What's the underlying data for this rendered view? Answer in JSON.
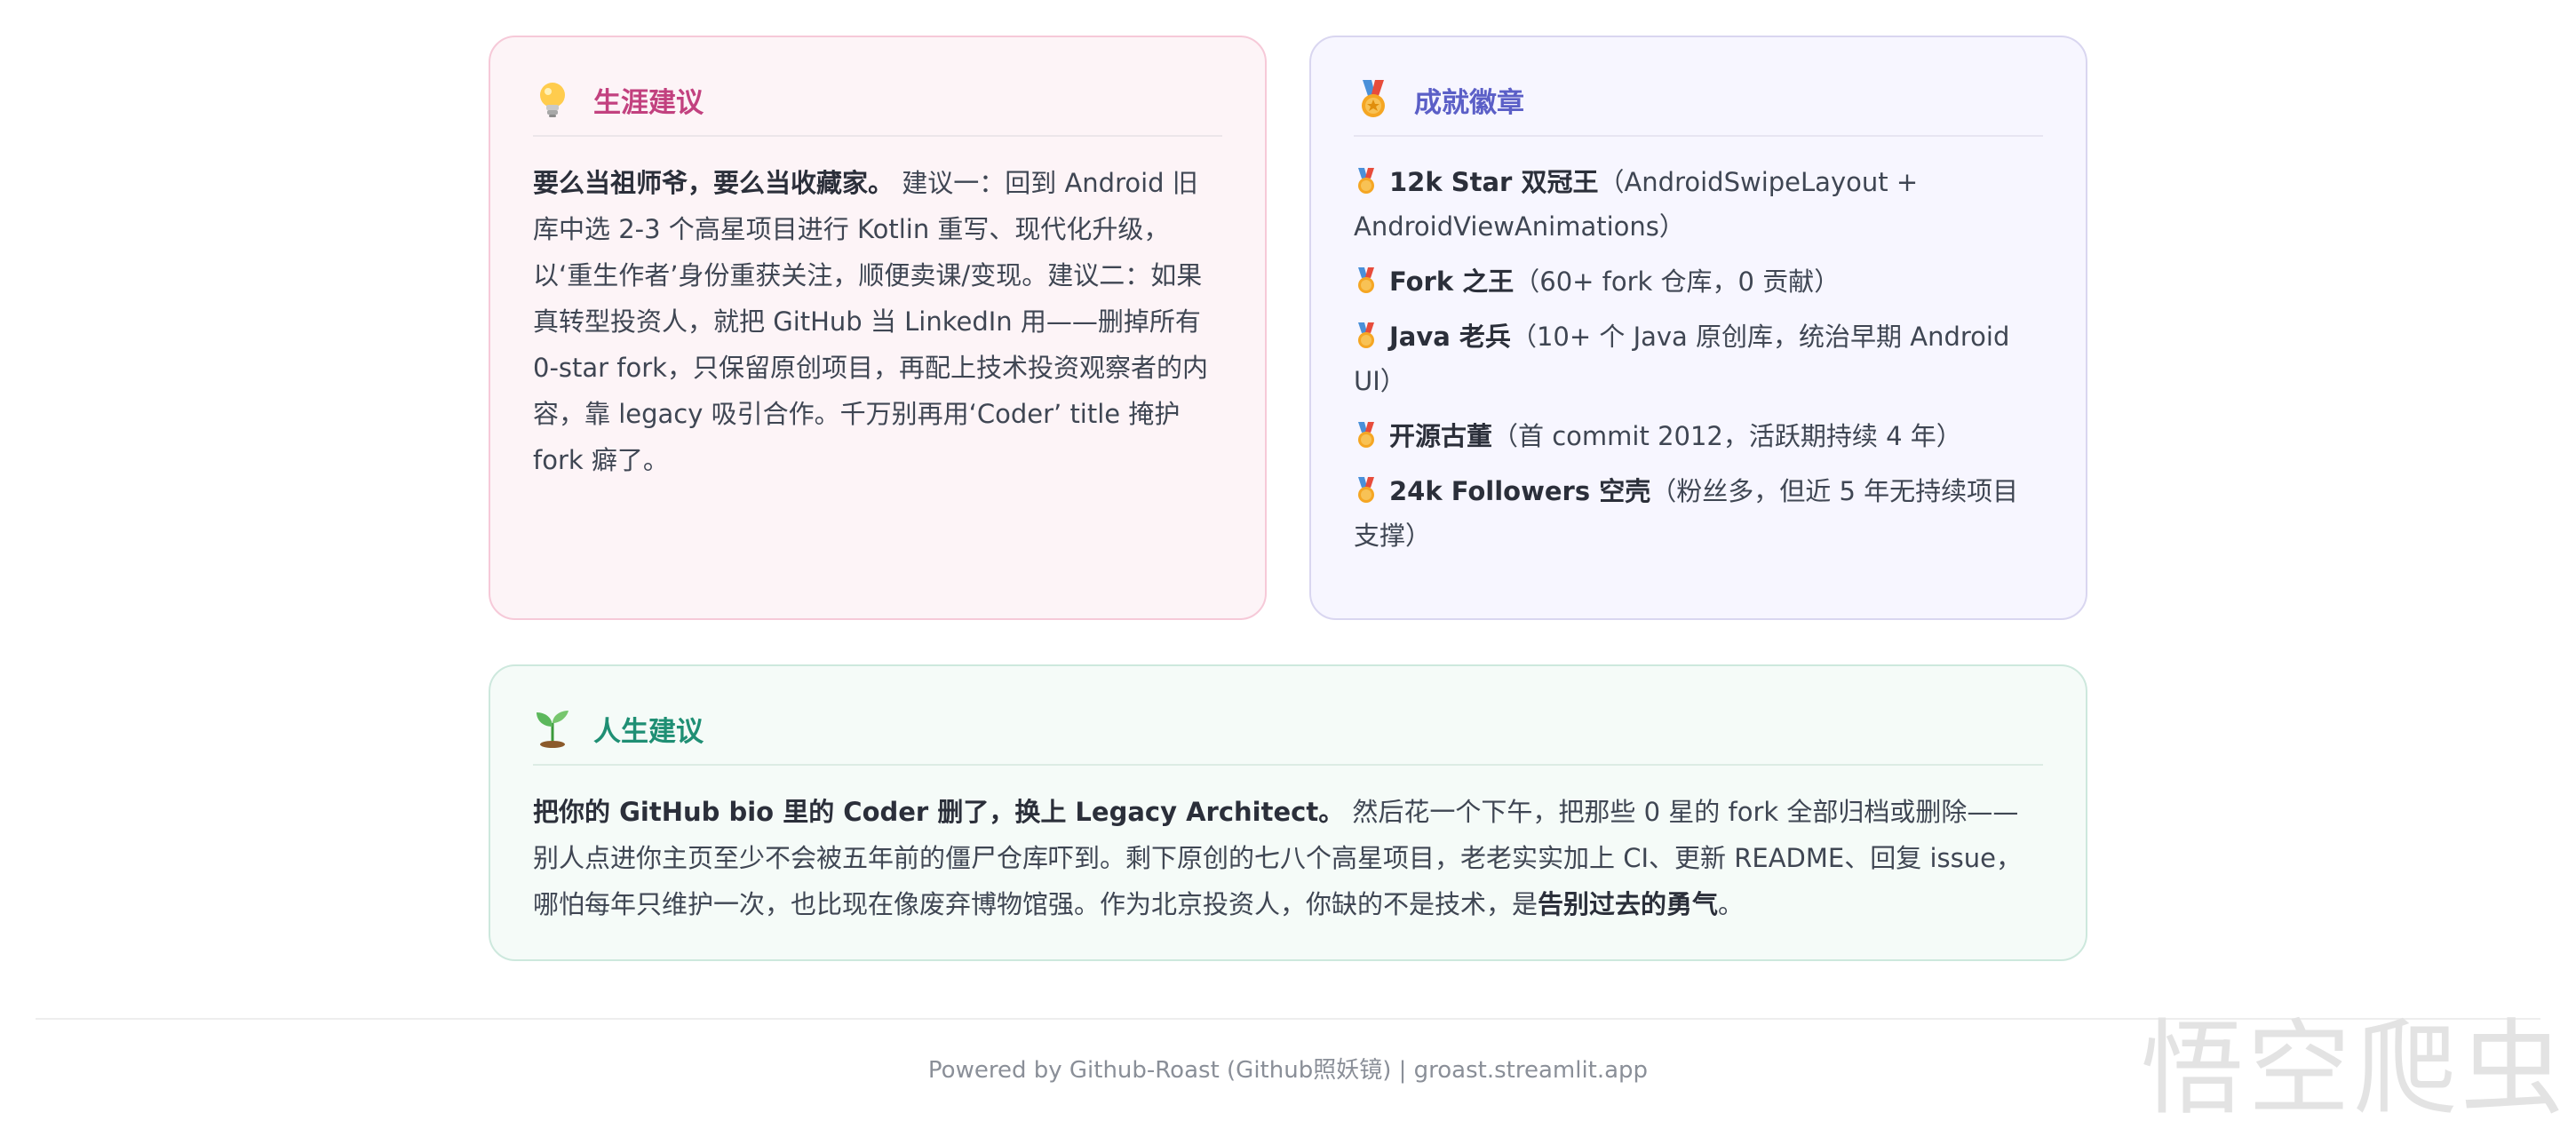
{
  "career": {
    "title": "生涯建议",
    "icon": "light-bulb-icon",
    "lead": "要么当祖师爷，要么当收藏家。",
    "text": " 建议一：回到 Android 旧库中选 2-3 个高星项目进行 Kotlin 重写、现代化升级，以‘重生作者’身份重获关注，顺便卖课/变现。建议二：如果真转型投资人，就把 GitHub 当 LinkedIn 用——删掉所有 0-star fork，只保留原创项目，再配上技术投资观察者的内容，靠 legacy 吸引合作。千万别再用‘Coder’ title 掩护 fork 癖了。"
  },
  "badges": {
    "title": "成就徽章",
    "icon": "medal-icon",
    "items": [
      {
        "name": "12k Star 双冠王",
        "desc": "（AndroidSwipeLayout + AndroidViewAnimations）"
      },
      {
        "name": "Fork 之王",
        "desc": "（60+ fork 仓库，0 贡献）"
      },
      {
        "name": "Java 老兵",
        "desc": "（10+ 个 Java 原创库，统治早期 Android UI）"
      },
      {
        "name": "开源古董",
        "desc": "（首 commit 2012，活跃期持续 4 年）"
      },
      {
        "name": "24k Followers 空壳",
        "desc": "（粉丝多，但近 5 年无持续项目支撑）"
      }
    ]
  },
  "life": {
    "title": "人生建议",
    "icon": "seedling-icon",
    "lead": "把你的 GitHub bio 里的 Coder 删了，换上 Legacy Architect。",
    "text": " 然后花一个下午，把那些 0 星的 fork 全部归档或删除——别人点进你主页至少不会被五年前的僵尸仓库吓到。剩下原创的七八个高星项目，老老实实加上 CI、更新 README、回复 issue，哪怕每年只维护一次，也比现在像废弃博物馆强。作为北京投资人，你缺的不是技术，是",
    "end_bold": "告别过去的勇气",
    "end_punct": "。"
  },
  "footer": {
    "text": "Powered by Github-Roast (Github照妖镜) | groast.streamlit.app"
  },
  "watermark": {
    "text": "悟空爬虫"
  },
  "colors": {
    "career_accent": "#c2417f",
    "badges_accent": "#5b5fc7",
    "life_accent": "#1f8f74"
  }
}
